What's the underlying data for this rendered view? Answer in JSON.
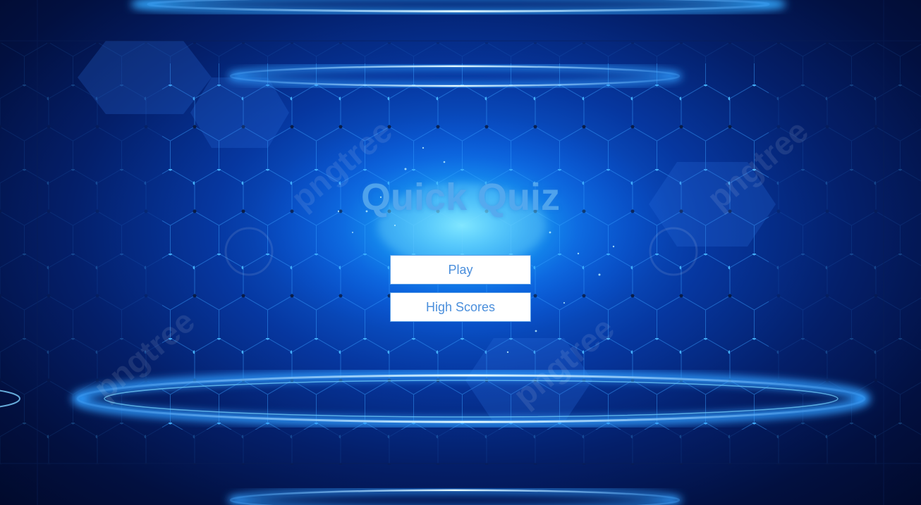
{
  "app": {
    "title": "Quick Quiz"
  },
  "menu": {
    "play_label": "Play",
    "high_scores_label": "High Scores"
  },
  "watermark": {
    "text": "pngtree"
  },
  "colors": {
    "title": "#56a8ee",
    "button_bg": "#ffffff",
    "button_text": "#4b8fdc",
    "background_core": "#17a6ff",
    "background_edge": "#010a2c"
  }
}
